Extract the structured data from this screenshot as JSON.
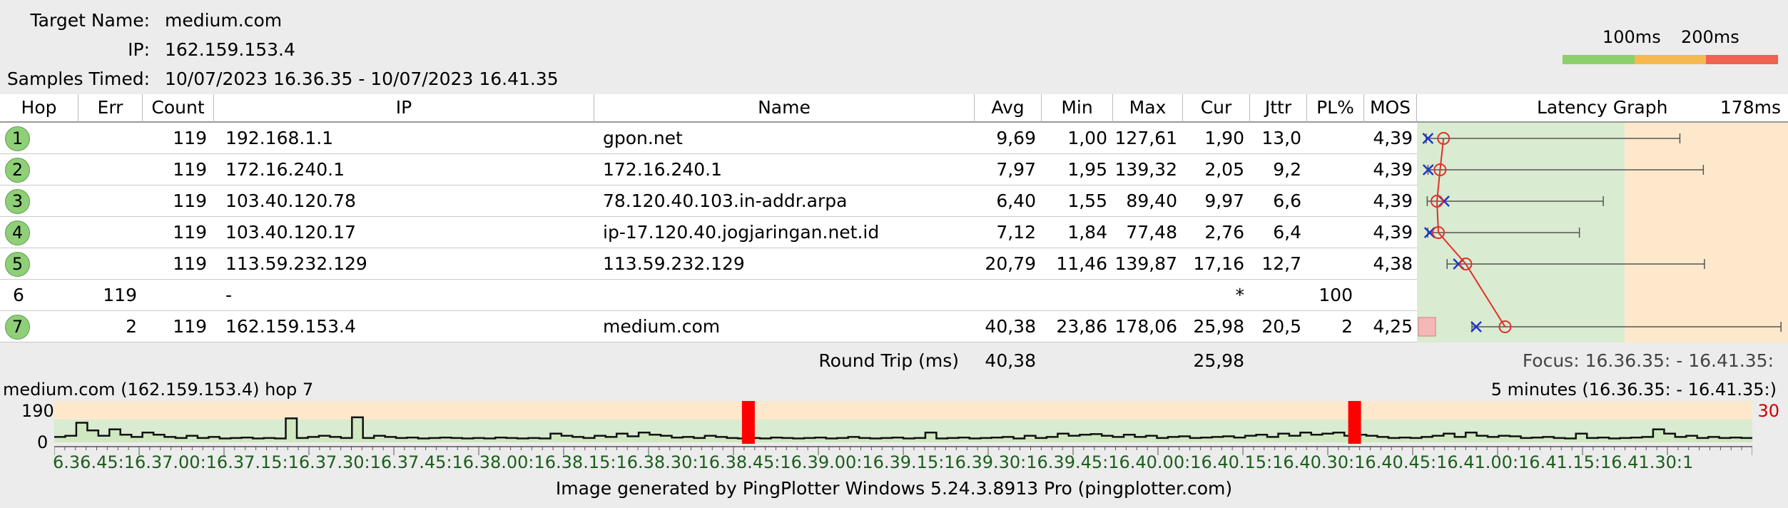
{
  "header": {
    "target_label": "Target Name:",
    "target_value": "medium.com",
    "ip_label": "IP:",
    "ip_value": "162.159.153.4",
    "samples_label": "Samples Timed:",
    "samples_value": "10/07/2023 16.36.35 - 10/07/2023 16.41.35",
    "scale_100": "100ms",
    "scale_200": "200ms",
    "colors": {
      "good": "#8dcf6b",
      "warn": "#f6b94f",
      "bad": "#f0624f"
    }
  },
  "columns": [
    "Hop",
    "Err",
    "Count",
    "IP",
    "Name",
    "Avg",
    "Min",
    "Max",
    "Cur",
    "Jttr",
    "PL%",
    "MOS",
    "Latency Graph",
    "178ms"
  ],
  "rows": [
    {
      "hop": "1",
      "err": "",
      "count": "119",
      "ip": "192.168.1.1",
      "name": "gpon.net",
      "avg": "9,69",
      "min": "1,00",
      "max": "127,61",
      "cur": "1,90",
      "jttr": "13,0",
      "pl": "",
      "mos": "4,39",
      "circle": true,
      "lat": {
        "min": 1.0,
        "avg": 9.69,
        "max": 127.61,
        "cur": 1.9
      }
    },
    {
      "hop": "2",
      "err": "",
      "count": "119",
      "ip": "172.16.240.1",
      "name": "172.16.240.1",
      "avg": "7,97",
      "min": "1,95",
      "max": "139,32",
      "cur": "2,05",
      "jttr": "9,2",
      "pl": "",
      "mos": "4,39",
      "circle": true,
      "lat": {
        "min": 1.95,
        "avg": 7.97,
        "max": 139.32,
        "cur": 2.05
      }
    },
    {
      "hop": "3",
      "err": "",
      "count": "119",
      "ip": "103.40.120.78",
      "name": "78.120.40.103.in-addr.arpa",
      "avg": "6,40",
      "min": "1,55",
      "max": "89,40",
      "cur": "9,97",
      "jttr": "6,6",
      "pl": "",
      "mos": "4,39",
      "circle": true,
      "lat": {
        "min": 1.55,
        "avg": 6.4,
        "max": 89.4,
        "cur": 9.97
      }
    },
    {
      "hop": "4",
      "err": "",
      "count": "119",
      "ip": "103.40.120.17",
      "name": "ip-17.120.40.jogjaringan.net.id",
      "avg": "7,12",
      "min": "1,84",
      "max": "77,48",
      "cur": "2,76",
      "jttr": "6,4",
      "pl": "",
      "mos": "4,39",
      "circle": true,
      "lat": {
        "min": 1.84,
        "avg": 7.12,
        "max": 77.48,
        "cur": 2.76
      }
    },
    {
      "hop": "5",
      "err": "",
      "count": "119",
      "ip": "113.59.232.129",
      "name": "113.59.232.129",
      "avg": "20,79",
      "min": "11,46",
      "max": "139,87",
      "cur": "17,16",
      "jttr": "12,7",
      "pl": "",
      "mos": "4,38",
      "circle": true,
      "lat": {
        "min": 11.46,
        "avg": 20.79,
        "max": 139.87,
        "cur": 17.16
      }
    },
    {
      "hop": "6",
      "err": "119",
      "count": "",
      "ip": "-",
      "name": "",
      "avg": "",
      "min": "",
      "max": "",
      "cur": "*",
      "jttr": "",
      "pl": "100",
      "mos": "",
      "circle": false,
      "lat": null
    },
    {
      "hop": "7",
      "err": "2",
      "count": "119",
      "ip": "162.159.153.4",
      "name": "medium.com",
      "avg": "40,38",
      "min": "23,86",
      "max": "178,06",
      "cur": "25,98",
      "jttr": "20,5",
      "pl": "2",
      "mos": "4,25",
      "circle": true,
      "lat": {
        "min": 23.86,
        "avg": 40.38,
        "max": 178.06,
        "cur": 25.98
      }
    }
  ],
  "graph": {
    "max_ms": 178
  },
  "roundtrip": {
    "label": "Round Trip (ms)",
    "avg": "40,38",
    "cur": "25,98",
    "focus": "Focus: 16.36.35: - 16.41.35:"
  },
  "timeline": {
    "title": "medium.com (162.159.153.4) hop 7",
    "range": "5 minutes (16.36.35: - 16.41.35:)",
    "y_top": "190",
    "y_zero": "0",
    "right_value": "30",
    "x_labels": "6.36.45:16.37.00:16.37.15:16.37.30:16.37.45:16.38.00:16.38.15:16.38.30:16.38.45:16.39.00:16.39.15:16.39.30:16.39.45:16.40.00:16.40.15:16.40.30:16.40.45:16.41.00:16.41.15:16.41.30:1",
    "samples": [
      25,
      30,
      90,
      55,
      30,
      60,
      35,
      25,
      45,
      35,
      25,
      20,
      30,
      20,
      25,
      18,
      20,
      22,
      18,
      20,
      18,
      110,
      20,
      25,
      30,
      25,
      20,
      115,
      20,
      30,
      25,
      20,
      22,
      18,
      20,
      22,
      20,
      18,
      20,
      18,
      22,
      20,
      18,
      20,
      18,
      40,
      30,
      25,
      20,
      30,
      25,
      40,
      28,
      45,
      35,
      30,
      22,
      25,
      20,
      30,
      25,
      20,
      18,
      20,
      18,
      22,
      20,
      18,
      20,
      22,
      18,
      20,
      25,
      20,
      18,
      20,
      22,
      18,
      20,
      45,
      18,
      20,
      22,
      18,
      20,
      22,
      25,
      18,
      30,
      20,
      25,
      40,
      30,
      35,
      38,
      30,
      25,
      35,
      25,
      30,
      20,
      25,
      28,
      20,
      22,
      25,
      28,
      22,
      30,
      35,
      25,
      40,
      30,
      45,
      35,
      40,
      45,
      30,
      35,
      30,
      25,
      20,
      22,
      20,
      25,
      30,
      40,
      25,
      45,
      30,
      25,
      30,
      28,
      20,
      22,
      25,
      20,
      18,
      40,
      20,
      22,
      18,
      20,
      22,
      25,
      60,
      40,
      25,
      30,
      20,
      25,
      20,
      22,
      20
    ],
    "loss_at": [
      0.405,
      0.762
    ]
  },
  "footer": "Image generated by PingPlotter Windows 5.24.3.8913 Pro (pingplotter.com)"
}
